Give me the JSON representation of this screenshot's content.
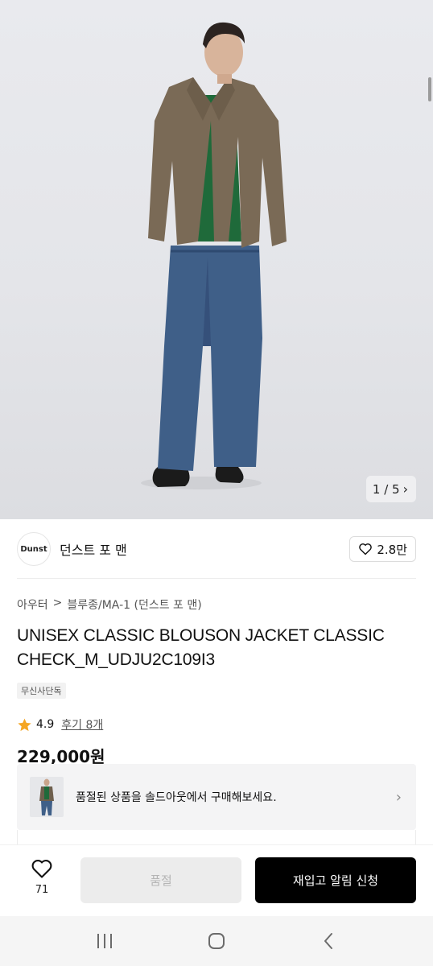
{
  "gallery": {
    "counter": "1 / 5"
  },
  "brand": {
    "logo_text": "Dunst",
    "name": "던스트 포 맨",
    "likes": "2.8만"
  },
  "breadcrumb": {
    "category": "아우터",
    "separator": ">",
    "subcategory": "블루종/MA-1 (던스트 포 맨)"
  },
  "product": {
    "title": "UNISEX CLASSIC BLOUSON JACKET CLASSIC CHECK_M_UDJU2C109I3",
    "badge": "무신사단독",
    "rating": "4.9",
    "reviews": "후기 8개",
    "price": "229,000원"
  },
  "soldout_banner": {
    "text": "품절된 상품을 솔드아웃에서 구매해보세요."
  },
  "action_bar": {
    "wish_count": "71",
    "soldout_label": "품절",
    "notify_label": "재입고 알림 신청"
  },
  "colors": {
    "star": "#f5a623",
    "primary_button": "#000000",
    "disabled_button": "#ececec"
  }
}
